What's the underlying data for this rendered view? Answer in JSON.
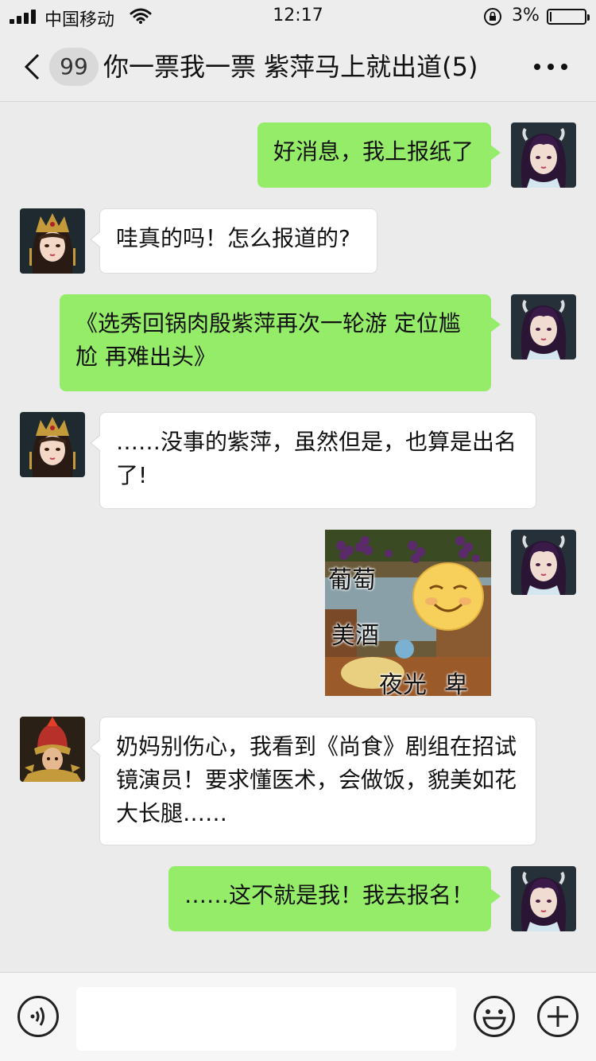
{
  "status_bar": {
    "carrier": "中国移动",
    "time": "12:17",
    "battery": "3%",
    "battery_level": 0.03
  },
  "nav": {
    "unread_count": "99",
    "title": "你一票我一票 紫萍马上就出道(5)",
    "icons": {
      "back": "chevron-left-icon",
      "more": "more-dots-icon"
    }
  },
  "messages": [
    {
      "sender": "me",
      "text": "好消息，我上报纸了"
    },
    {
      "sender": "other",
      "text": "哇真的吗！怎么报道的?"
    },
    {
      "sender": "me",
      "text": "《选秀回锅肉殷紫萍再次一轮游 定位尴尬 再难出头》"
    },
    {
      "sender": "other",
      "text": "……没事的紫萍，虽然但是，也算是出名了!"
    },
    {
      "sender": "me",
      "type": "sticker",
      "sticker_text": [
        "葡萄",
        "美酒",
        "夜光",
        "卑"
      ]
    },
    {
      "sender": "other",
      "text": "奶妈别伤心，我看到《尚食》剧组在招试镜演员！要求懂医术，会做饭，貌美如花大长腿……"
    },
    {
      "sender": "me",
      "text": "……这不就是我！我去报名！"
    }
  ],
  "input_bar": {
    "placeholder": "",
    "icons": {
      "voice": "voice-icon",
      "emoji": "emoji-icon",
      "add": "add-icon"
    }
  },
  "colors": {
    "my_bubble": "#95ec69",
    "other_bubble": "#ffffff",
    "background": "#ebebeb"
  }
}
